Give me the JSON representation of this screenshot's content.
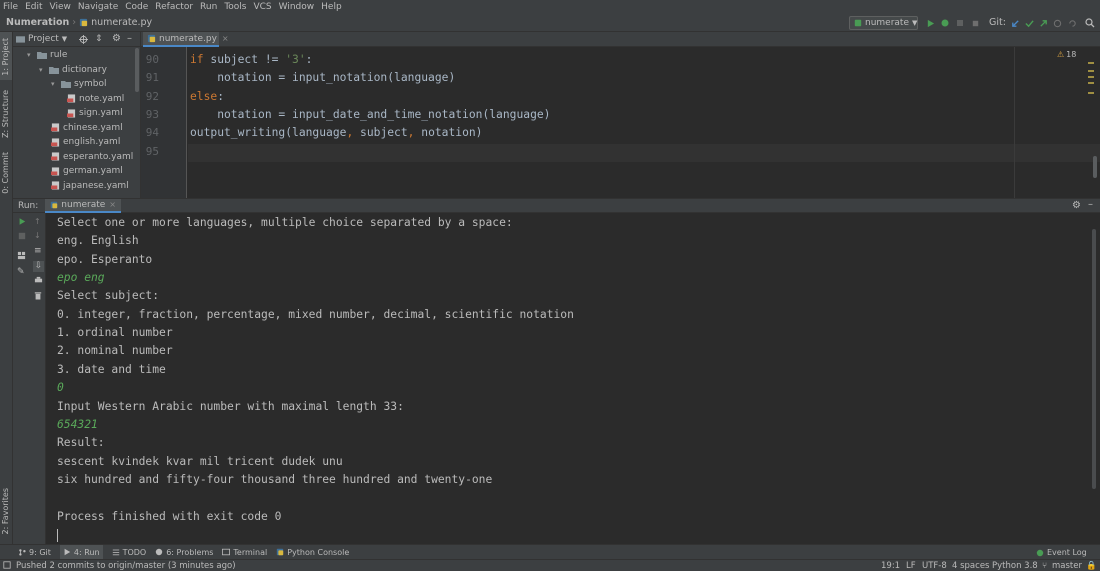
{
  "menu": [
    "File",
    "Edit",
    "View",
    "Navigate",
    "Code",
    "Refactor",
    "Run",
    "Tools",
    "VCS",
    "Window",
    "Help"
  ],
  "navbar": {
    "project": "Numeration",
    "file": "numerate.py",
    "run_config": "numerate",
    "git_label": "Git:"
  },
  "left_strip": {
    "project": "1: Project",
    "structure": "Z: Structure",
    "commit": "0: Commit",
    "favorites": "2: Favorites"
  },
  "project_panel": {
    "header": "Project",
    "tree": [
      {
        "label": "rule",
        "type": "folder",
        "depth": 0,
        "expanded": true
      },
      {
        "label": "dictionary",
        "type": "folder",
        "depth": 1,
        "expanded": true
      },
      {
        "label": "symbol",
        "type": "folder",
        "depth": 2,
        "expanded": true
      },
      {
        "label": "note.yaml",
        "type": "file",
        "depth": 3
      },
      {
        "label": "sign.yaml",
        "type": "file",
        "depth": 3
      },
      {
        "label": "chinese.yaml",
        "type": "file",
        "depth": 2
      },
      {
        "label": "english.yaml",
        "type": "file",
        "depth": 2
      },
      {
        "label": "esperanto.yaml",
        "type": "file",
        "depth": 2
      },
      {
        "label": "german.yaml",
        "type": "file",
        "depth": 2
      },
      {
        "label": "japanese.yaml",
        "type": "file",
        "depth": 2
      }
    ]
  },
  "editor": {
    "tab": "numerate.py",
    "warnings_count": "18",
    "lines": [
      {
        "num": "90",
        "parts": [
          [
            "kw",
            "if "
          ],
          [
            "fn",
            "subject != "
          ],
          [
            "str",
            "'3'"
          ],
          [
            "fn",
            ":"
          ]
        ]
      },
      {
        "num": "91",
        "parts": [
          [
            "fn",
            "    notation = input_notation(language)"
          ]
        ]
      },
      {
        "num": "92",
        "parts": [
          [
            "kw",
            "else"
          ],
          [
            "fn",
            ":"
          ]
        ]
      },
      {
        "num": "93",
        "parts": [
          [
            "fn",
            "    notation = input_date_and_time_notation(language)"
          ]
        ]
      },
      {
        "num": "94",
        "parts": [
          [
            "fn",
            "output_writing(language"
          ],
          [
            "kw",
            ", "
          ],
          [
            "fn",
            "subject"
          ],
          [
            "kw",
            ", "
          ],
          [
            "fn",
            "notation)"
          ]
        ]
      },
      {
        "num": "95",
        "parts": []
      }
    ]
  },
  "run_panel": {
    "label": "Run:",
    "tab": "numerate",
    "console": [
      {
        "text": "Select one or more languages, multiple choice separated by a space:",
        "input": false
      },
      {
        "text": "eng. English",
        "input": false
      },
      {
        "text": "epo. Esperanto",
        "input": false
      },
      {
        "text": "epo eng",
        "input": true
      },
      {
        "text": "Select subject:",
        "input": false
      },
      {
        "text": "0. integer, fraction, percentage, mixed number, decimal, scientific notation",
        "input": false
      },
      {
        "text": "1. ordinal number",
        "input": false
      },
      {
        "text": "2. nominal number",
        "input": false
      },
      {
        "text": "3. date and time",
        "input": false
      },
      {
        "text": "0",
        "input": true
      },
      {
        "text": "Input Western Arabic number with maximal length 33:",
        "input": false
      },
      {
        "text": "654321",
        "input": true
      },
      {
        "text": "Result:",
        "input": false
      },
      {
        "text": "sescent kvindek kvar mil tricent dudek unu",
        "input": false
      },
      {
        "text": "six hundred and fifty-four thousand three hundred and twenty-one",
        "input": false
      },
      {
        "text": "",
        "input": false
      },
      {
        "text": "Process finished with exit code 0",
        "input": false
      }
    ]
  },
  "bottom_tabs": [
    "9: Git",
    "4: Run",
    "TODO",
    "6: Problems",
    "Terminal",
    "Python Console"
  ],
  "event_log": "Event Log",
  "status": {
    "message": "Pushed 2 commits to origin/master (3 minutes ago)",
    "position": "19:1",
    "line_sep": "LF",
    "encoding": "UTF-8",
    "indent": "4 spaces",
    "interpreter": "Python 3.8",
    "branch": "master"
  },
  "colors": {
    "accent": "#4a88c7",
    "run_green": "#499c54",
    "input_green": "#5aa95a",
    "keyword": "#cc7832",
    "string": "#6a8759"
  }
}
